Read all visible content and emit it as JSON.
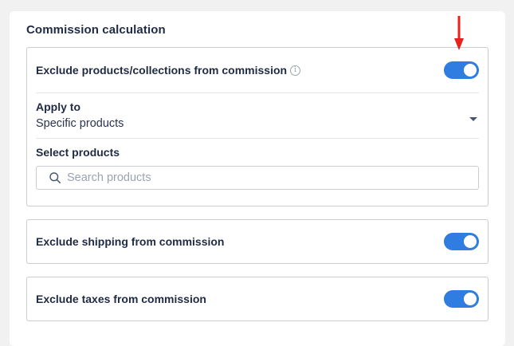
{
  "section": {
    "title": "Commission calculation"
  },
  "exclude_products": {
    "label": "Exclude products/collections from commission",
    "info_icon": "info-icon",
    "toggle_on": true,
    "apply_to_label": "Apply to",
    "apply_to_value": "Specific products",
    "select_products_label": "Select products",
    "search_placeholder": "Search products"
  },
  "exclude_shipping": {
    "label": "Exclude shipping from commission",
    "toggle_on": true
  },
  "exclude_taxes": {
    "label": "Exclude taxes from commission",
    "toggle_on": true
  },
  "colors": {
    "toggle_accent": "#2f7de1",
    "annotation_arrow": "#e8211e"
  }
}
